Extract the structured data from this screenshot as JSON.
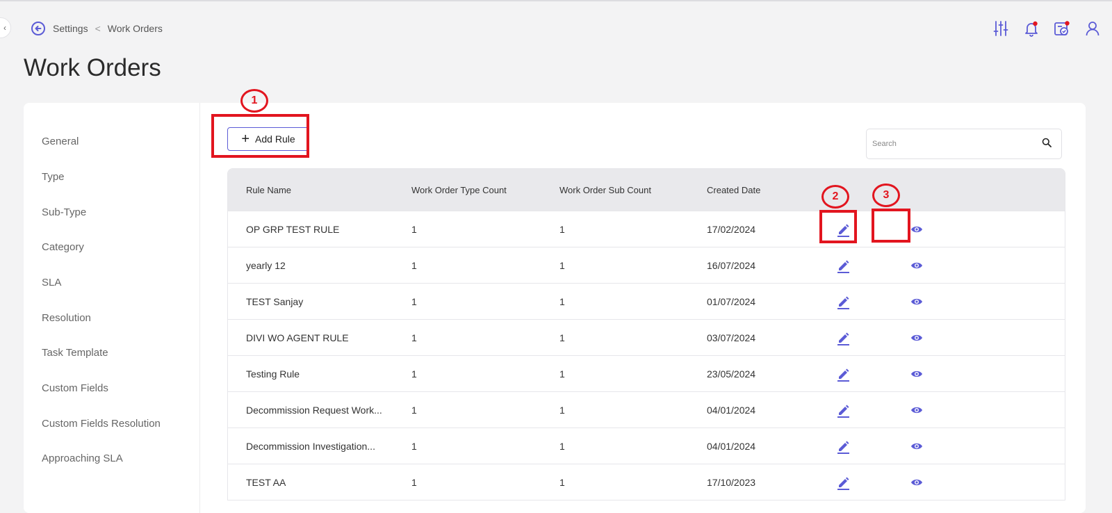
{
  "breadcrumb": {
    "items": [
      "Settings",
      "Work Orders"
    ],
    "separator": "<"
  },
  "page": {
    "title": "Work Orders"
  },
  "header_icons": [
    "filter-settings-icon",
    "notification-bell-icon",
    "task-calendar-icon",
    "user-icon"
  ],
  "sidebar": {
    "items": [
      {
        "label": "General"
      },
      {
        "label": "Type"
      },
      {
        "label": "Sub-Type"
      },
      {
        "label": "Category"
      },
      {
        "label": "SLA"
      },
      {
        "label": "Resolution"
      },
      {
        "label": "Task Template"
      },
      {
        "label": "Custom Fields"
      },
      {
        "label": "Custom Fields Resolution"
      },
      {
        "label": "Approaching SLA"
      }
    ]
  },
  "toolbar": {
    "add_rule_label": "Add Rule",
    "search_placeholder": "Search"
  },
  "table": {
    "columns": [
      "Rule Name",
      "Work Order Type Count",
      "Work Order Sub Count",
      "Created Date"
    ],
    "rows": [
      {
        "name": "OP GRP TEST RULE",
        "type_count": "1",
        "sub_count": "1",
        "created": "17/02/2024"
      },
      {
        "name": "yearly 12",
        "type_count": "1",
        "sub_count": "1",
        "created": "16/07/2024"
      },
      {
        "name": "TEST Sanjay",
        "type_count": "1",
        "sub_count": "1",
        "created": "01/07/2024"
      },
      {
        "name": "DIVI WO AGENT RULE",
        "type_count": "1",
        "sub_count": "1",
        "created": "03/07/2024"
      },
      {
        "name": "Testing Rule",
        "type_count": "1",
        "sub_count": "1",
        "created": "23/05/2024"
      },
      {
        "name": "Decommission Request Work...",
        "type_count": "1",
        "sub_count": "1",
        "created": "04/01/2024"
      },
      {
        "name": "Decommission Investigation...",
        "type_count": "1",
        "sub_count": "1",
        "created": "04/01/2024"
      },
      {
        "name": "TEST AA",
        "type_count": "1",
        "sub_count": "1",
        "created": "17/10/2023"
      }
    ]
  },
  "annotations": [
    "1",
    "2",
    "3"
  ],
  "colors": {
    "accent": "#5b5bd6",
    "annotation": "#e2151f",
    "background": "#f3f3f4",
    "header_row": "#e9e9ec"
  }
}
